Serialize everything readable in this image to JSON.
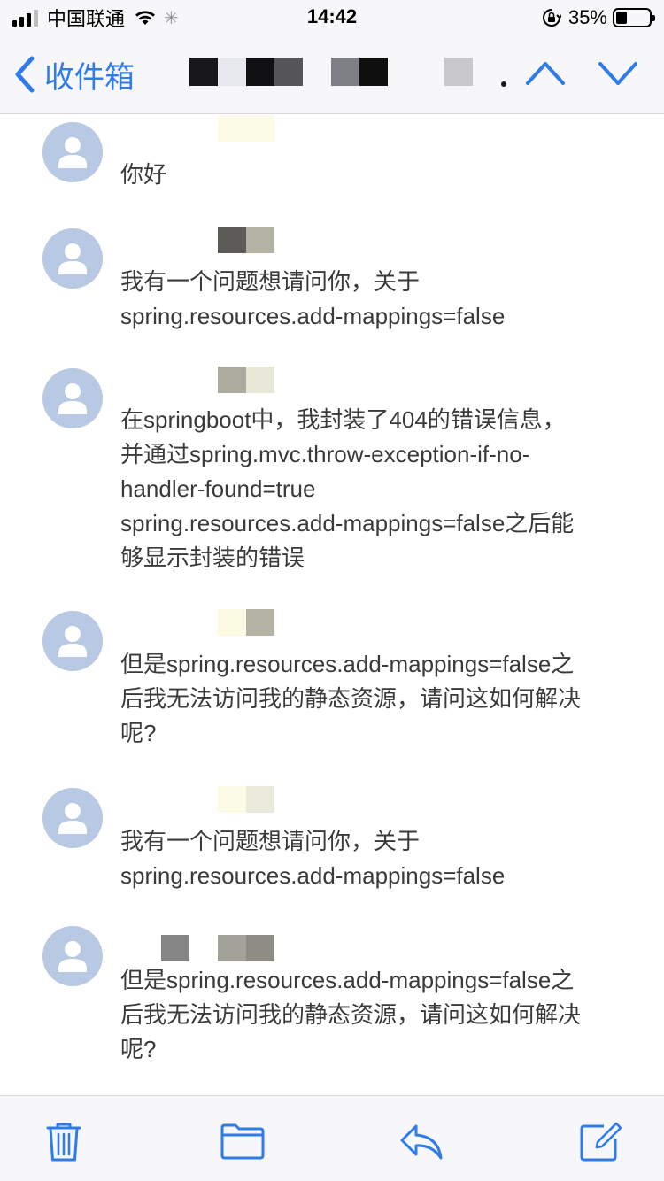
{
  "status_bar": {
    "carrier": "中国联通",
    "time": "14:42",
    "battery": "35%"
  },
  "nav": {
    "back_label": "收件箱"
  },
  "messages": [
    {
      "text": "你好"
    },
    {
      "text": "我有一个问题想请问你，关于\nspring.resources.add-mappings=false"
    },
    {
      "text": "在springboot中，我封装了404的错误信息，\n并通过spring.mvc.throw-exception-if-no-\nhandler-found=true\nspring.resources.add-mappings=false之后能\n够显示封装的错误"
    },
    {
      "text": "但是spring.resources.add-mappings=false之\n后我无法访问我的静态资源，请问这如何解决\n呢?"
    },
    {
      "text": "我有一个问题想请问你，关于\nspring.resources.add-mappings=false"
    },
    {
      "text": "但是spring.resources.add-mappings=false之\n后我无法访问我的静态资源，请问这如何解决\n呢?"
    }
  ],
  "colors": {
    "accent": "#2f7bea",
    "avatar": "#b8c9e3"
  },
  "toolbar": {
    "icons": [
      "trash-icon",
      "folder-icon",
      "reply-icon",
      "compose-icon"
    ]
  }
}
